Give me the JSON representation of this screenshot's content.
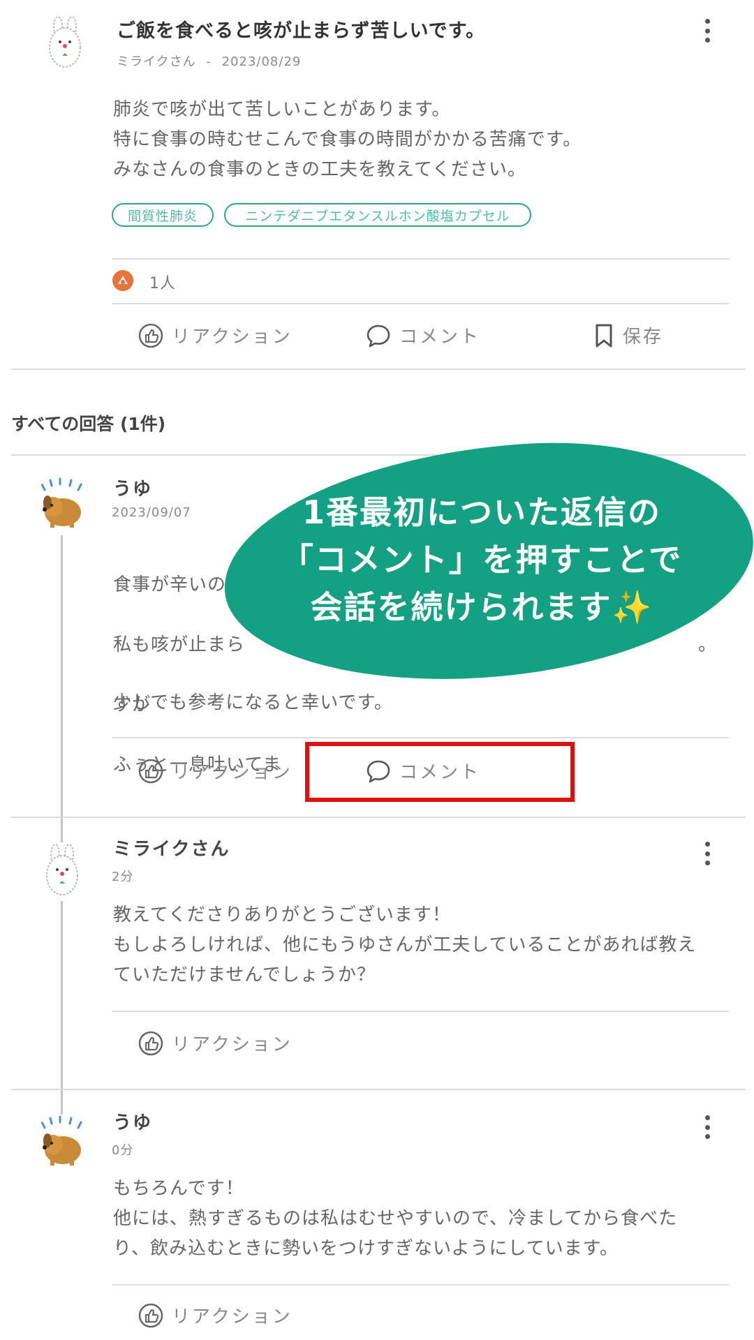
{
  "question": {
    "title": "ご飯を食べると咳が止まらず苦しいです。",
    "author": "ミライクさん",
    "separator": "-",
    "date": "2023/08/29",
    "body": "肺炎で咳が出て苦しいことがあります。\n特に食事の時むせこんで食事の時間がかかる苦痛です。\nみなさんの食事のときの工夫を教えてください。",
    "tags": [
      "間質性肺炎",
      "ニンテダニブエタンスルホン酸塩カプセル"
    ],
    "reaction_count": "1人",
    "actions": {
      "reaction": "リアクション",
      "comment": "コメント",
      "save": "保存"
    }
  },
  "answers_header": "すべての回答 (1件)",
  "answer": {
    "author": "うゆ",
    "date": "2023/09/07",
    "body_lines": [
      "食事が辛いの",
      "私も咳が止まら",
      "すが",
      "ふぅと一息吐いてま",
      "。"
    ],
    "closing": "少しでも参考になると幸いです。",
    "actions": {
      "reaction": "リアクション",
      "comment": "コメント"
    }
  },
  "callout": {
    "line1": "1番最初についた返信の",
    "line2": "「コメント」を押すことで",
    "line3": "会話を続けられます✨",
    "color": "#14a082"
  },
  "highlight_color": "#e01010",
  "replies": [
    {
      "author": "ミライクさん",
      "time": "2分",
      "body": "教えてくださりありがとうございます！\nもしよろしければ、他にもうゆさんが工夫していることがあれば教え\nていただけませんでしょうか？",
      "reaction": "リアクション"
    },
    {
      "author": "うゆ",
      "time": "0分",
      "body": "もちろんです！\n他には、熱すぎるものは私はむせやすいので、冷ましてから食べた\nり、飲み込むときに勢いをつけすぎないようにしています。",
      "reaction": "リアクション"
    }
  ],
  "icons": {
    "more": "more-vertical-icon",
    "reaction": "thumbs-up-icon",
    "comment": "speech-bubble-icon",
    "save": "bookmark-icon",
    "badge": "reaction-badge-icon"
  }
}
